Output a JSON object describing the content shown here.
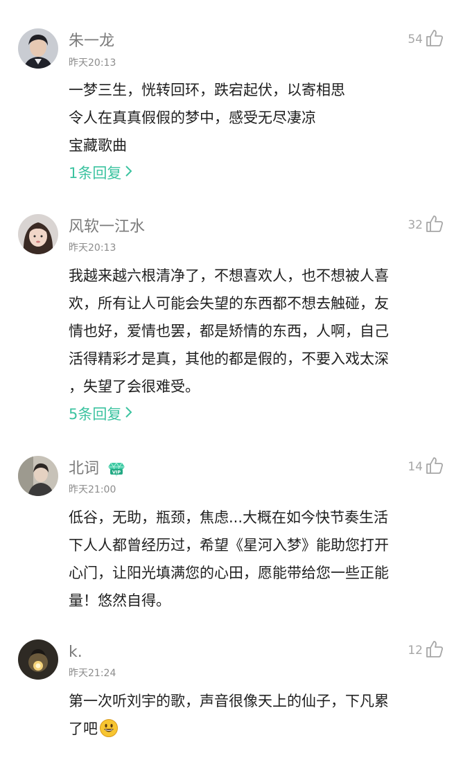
{
  "comments": [
    {
      "username": "朱一龙",
      "time": "昨天20:13",
      "likes": "54",
      "lines": [
        "一梦三生，恍转回环，跌宕起伏，以寄相思",
        "令人在真真假假的梦中，感受无尽凄凉",
        "宝藏歌曲"
      ],
      "reply": "1条回复"
    },
    {
      "username": "风软一江水",
      "time": "昨天20:13",
      "likes": "32",
      "lines": [
        "我越来越六根清净了，不想喜欢人，也不想被人喜",
        "欢，所有让人可能会失望的东西都不想去触碰，友",
        "情也好，爱情也罢，都是矫情的东西，人啊，自己",
        "活得精彩才是真，其他的都是假的，不要入戏太深",
        "，失望了会很难受。"
      ],
      "reply": "5条回复"
    },
    {
      "username": "北词",
      "time": "昨天21:00",
      "likes": "14",
      "badge": "VIP",
      "lines": [
        "低谷，无助，瓶颈，焦虑...大概在如今快节奏生活",
        "下人人都曾经历过，希望《星河入梦》能助您打开",
        "心门，让阳光填满您的心田，愿能带给您一些正能",
        "量！悠然自得。"
      ]
    },
    {
      "username": "k.",
      "time": "昨天21:24",
      "likes": "12",
      "lines": [
        "第一次听刘宇的歌，声音很像天上的仙子，下凡累",
        "了吧"
      ],
      "emoji": "smile-emoji"
    }
  ],
  "colors": {
    "reply": "#3cc3a0",
    "name": "#7a7a7a",
    "time": "#8c8c8c",
    "like": "#a6a6a6"
  }
}
